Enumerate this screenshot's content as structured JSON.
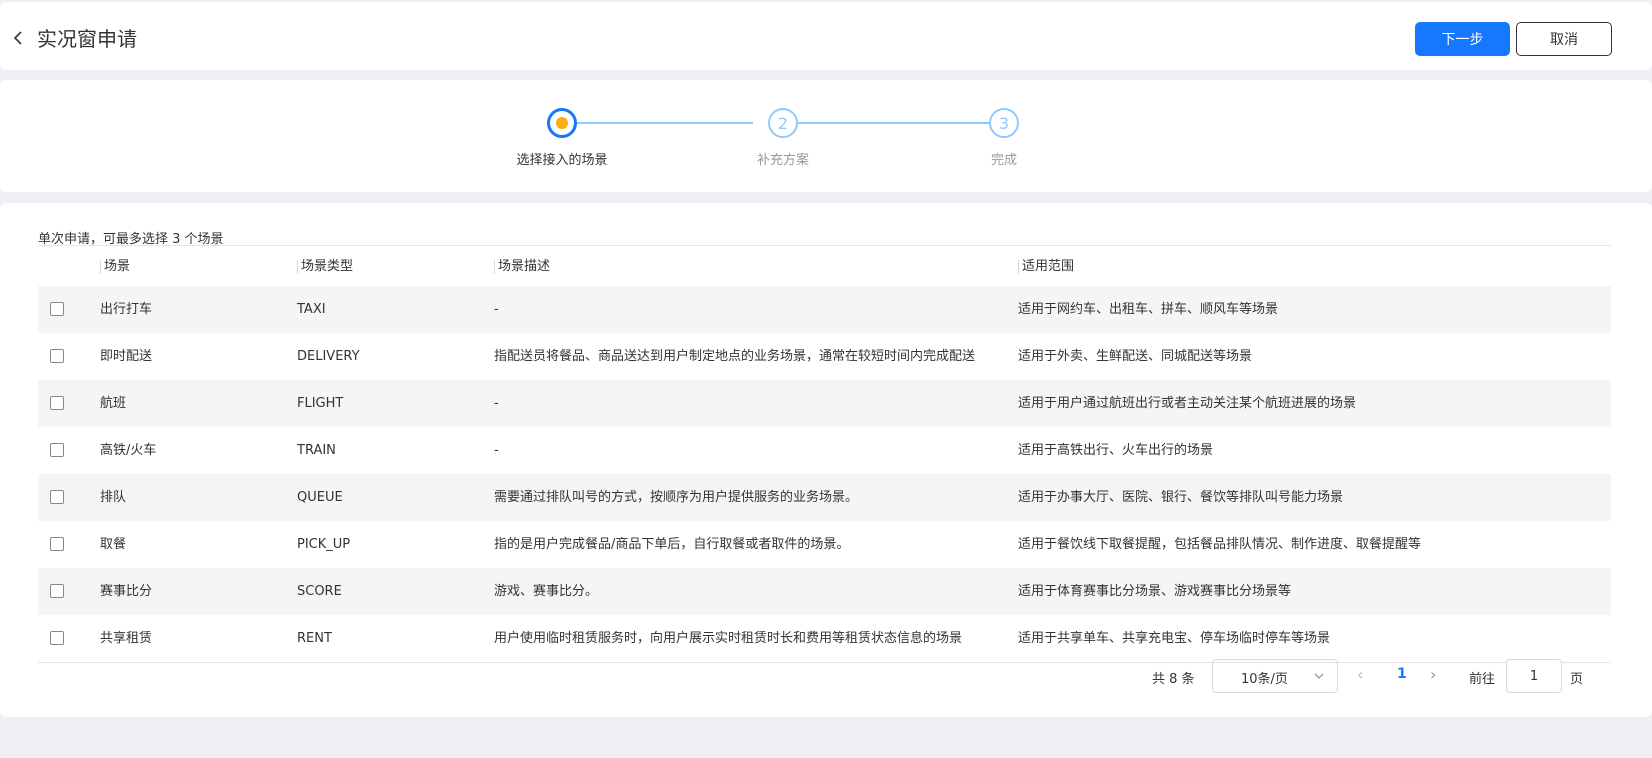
{
  "header": {
    "title": "实况窗申请",
    "next_label": "下一步",
    "cancel_label": "取消"
  },
  "steps": [
    {
      "label": "选择接入的场景",
      "number": "1",
      "state": "active"
    },
    {
      "label": "补充方案",
      "number": "2",
      "state": "pending"
    },
    {
      "label": "完成",
      "number": "3",
      "state": "pending"
    }
  ],
  "content": {
    "hint": "单次申请，可最多选择 3 个场景",
    "columns": [
      "场景",
      "场景类型",
      "场景描述",
      "适用范围"
    ],
    "rows": [
      {
        "name": "出行打车",
        "type": "TAXI",
        "desc": "-",
        "scope": "适用于网约车、出租车、拼车、顺风车等场景"
      },
      {
        "name": "即时配送",
        "type": "DELIVERY",
        "desc": "指配送员将餐品、商品送达到用户制定地点的业务场景，通常在较短时间内完成配送",
        "scope": "适用于外卖、生鲜配送、同城配送等场景"
      },
      {
        "name": "航班",
        "type": "FLIGHT",
        "desc": "-",
        "scope": "适用于用户通过航班出行或者主动关注某个航班进展的场景"
      },
      {
        "name": "高铁/火车",
        "type": "TRAIN",
        "desc": "-",
        "scope": "适用于高铁出行、火车出行的场景"
      },
      {
        "name": "排队",
        "type": "QUEUE",
        "desc": "需要通过排队叫号的方式，按顺序为用户提供服务的业务场景。",
        "scope": "适用于办事大厅、医院、银行、餐饮等排队叫号能力场景"
      },
      {
        "name": "取餐",
        "type": "PICK_UP",
        "desc": "指的是用户完成餐品/商品下单后，自行取餐或者取件的场景。",
        "scope": "适用于餐饮线下取餐提醒，包括餐品排队情况、制作进度、取餐提醒等"
      },
      {
        "name": "赛事比分",
        "type": "SCORE",
        "desc": "游戏、赛事比分。",
        "scope": "适用于体育赛事比分场景、游戏赛事比分场景等"
      },
      {
        "name": "共享租赁",
        "type": "RENT",
        "desc": "用户使用临时租赁服务时，向用户展示实时租赁时长和费用等租赁状态信息的场景",
        "scope": "适用于共享单车、共享充电宝、停车场临时停车等场景"
      }
    ]
  },
  "pagination": {
    "total": "共 8 条",
    "page_size": "10条/页",
    "current_page": "1",
    "goto_label": "前往",
    "goto_value": "1",
    "page_suffix": "页"
  }
}
